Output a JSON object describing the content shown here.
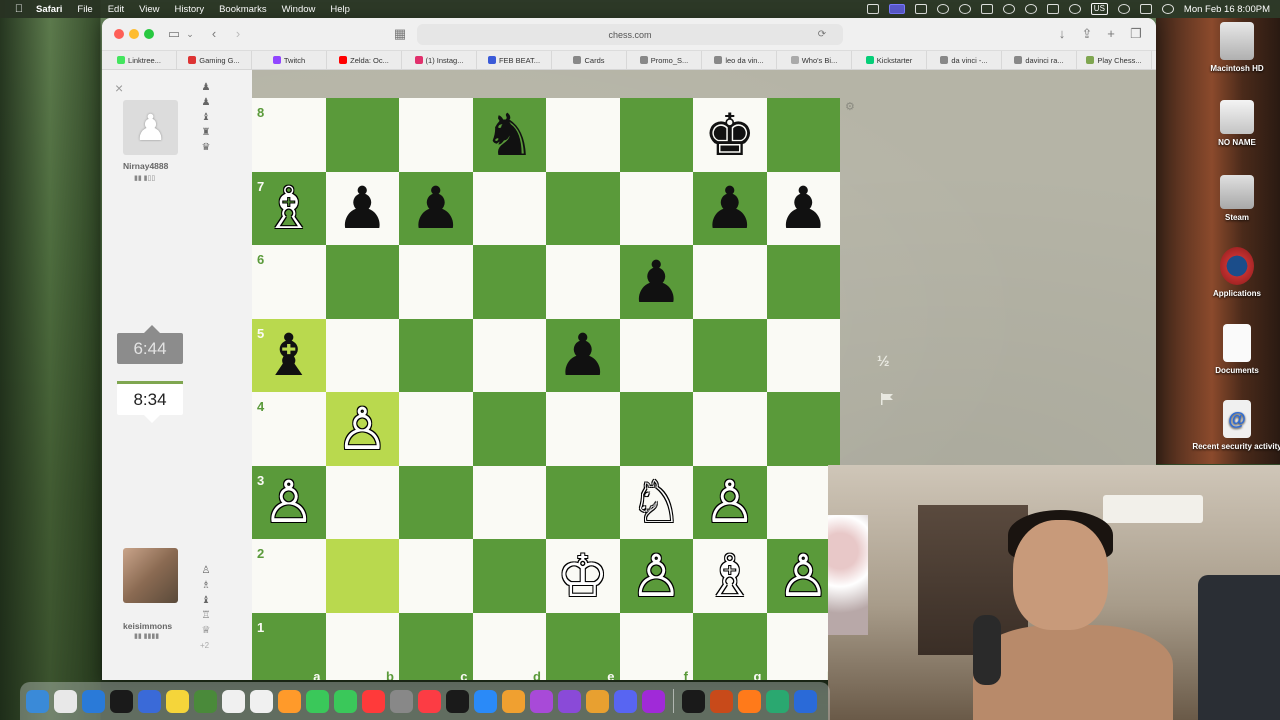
{
  "menubar": {
    "app_name": "Safari",
    "items": [
      "File",
      "Edit",
      "View",
      "History",
      "Bookmarks",
      "Window",
      "Help"
    ],
    "input_source": "US",
    "datetime": "Mon Feb 16  8:00PM"
  },
  "browser": {
    "url": "chess.com",
    "favorites": [
      {
        "label": "Linktree...",
        "color": "#43e55e"
      },
      {
        "label": "Gaming G...",
        "color": "#d33"
      },
      {
        "label": "Twitch",
        "color": "#9146ff"
      },
      {
        "label": "Zelda: Oc...",
        "color": "#ff0000"
      },
      {
        "label": "(1) Instag...",
        "color": "#e1306c"
      },
      {
        "label": "FEB BEAT...",
        "color": "#3a5ad8"
      },
      {
        "label": "Cards",
        "color": "#888"
      },
      {
        "label": "Promo_S...",
        "color": "#888"
      },
      {
        "label": "leo da vin...",
        "color": "#888"
      },
      {
        "label": "Who's Bi...",
        "color": "#aaa"
      },
      {
        "label": "Kickstarter",
        "color": "#05ce78"
      },
      {
        "label": "da vinci -...",
        "color": "#888"
      },
      {
        "label": "davinci ra...",
        "color": "#888"
      },
      {
        "label": "Play Chess...",
        "color": "#7fa650"
      }
    ]
  },
  "game": {
    "opponent": {
      "name": "Nirnay4888",
      "clock": "6:44",
      "captured": [
        "♟",
        "♟",
        "♝",
        "♜",
        "♛"
      ]
    },
    "player": {
      "name": "keisimmons",
      "clock": "8:34",
      "captured": [
        "♙",
        "♗",
        "♝",
        "♖",
        "♕"
      ],
      "material": "+2"
    },
    "draw_label": "½",
    "board": {
      "ranks": [
        "8",
        "7",
        "6",
        "5",
        "4",
        "3",
        "2",
        "1"
      ],
      "files": [
        "a",
        "b",
        "c",
        "d",
        "e",
        "f",
        "g",
        "h"
      ],
      "highlighted": [
        "b4",
        "b2",
        "a5"
      ],
      "pieces": [
        {
          "sq": "d8",
          "glyph": "♞",
          "color": "b"
        },
        {
          "sq": "g8",
          "glyph": "♚",
          "color": "b"
        },
        {
          "sq": "a7",
          "glyph": "♗",
          "color": "w"
        },
        {
          "sq": "b7",
          "glyph": "♟",
          "color": "b"
        },
        {
          "sq": "c7",
          "glyph": "♟",
          "color": "b"
        },
        {
          "sq": "g7",
          "glyph": "♟",
          "color": "b"
        },
        {
          "sq": "h7",
          "glyph": "♟",
          "color": "b"
        },
        {
          "sq": "f6",
          "glyph": "♟",
          "color": "b"
        },
        {
          "sq": "a5",
          "glyph": "♝",
          "color": "b"
        },
        {
          "sq": "e5",
          "glyph": "♟",
          "color": "b"
        },
        {
          "sq": "b4",
          "glyph": "♙",
          "color": "w"
        },
        {
          "sq": "a3",
          "glyph": "♙",
          "color": "w"
        },
        {
          "sq": "f3",
          "glyph": "♘",
          "color": "w"
        },
        {
          "sq": "g3",
          "glyph": "♙",
          "color": "w"
        },
        {
          "sq": "e2",
          "glyph": "♔",
          "color": "w"
        },
        {
          "sq": "f2",
          "glyph": "♙",
          "color": "w"
        },
        {
          "sq": "g2",
          "glyph": "♗",
          "color": "w"
        },
        {
          "sq": "h2",
          "glyph": "♙",
          "color": "w"
        }
      ]
    }
  },
  "desktop_icons": [
    {
      "id": "hd",
      "label": "Macintosh HD"
    },
    {
      "id": "noname",
      "label": "NO NAME"
    },
    {
      "id": "steam",
      "label": "Steam"
    },
    {
      "id": "apps",
      "label": "Applications"
    },
    {
      "id": "docs",
      "label": "Documents"
    },
    {
      "id": "sec",
      "label": "Recent security activity"
    }
  ],
  "dock_colors": [
    "#3a8ad8",
    "#e8e8e8",
    "#2a7ad8",
    "#1a1a1a",
    "#3a6ad8",
    "#f5d53a",
    "#4a8a3a",
    "#f0f0f0",
    "#f0f0f0",
    "#ff9a2a",
    "#3ac85a",
    "#3ac85a",
    "#ff3a3a",
    "#888888",
    "#fc3c44",
    "#1a1a1a",
    "#2a8af8",
    "#f0a030",
    "#a84ad8",
    "#8a4ad8",
    "#e8a030",
    "#5865f2",
    "#a02ad8",
    "#1a1a1a",
    "#c84a1a",
    "#ff7a1a",
    "#2aa870",
    "#2a6ad8"
  ]
}
